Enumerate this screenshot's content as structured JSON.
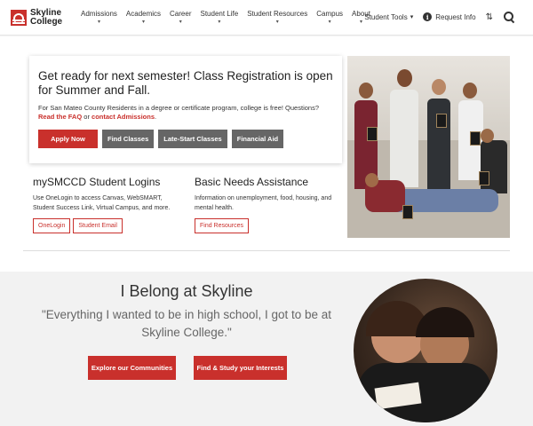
{
  "header": {
    "logo_line1": "Skyline",
    "logo_line2": "College",
    "nav": [
      {
        "label": "Admissions",
        "caret": "▾"
      },
      {
        "label": "Academics",
        "caret": "▾"
      },
      {
        "label": "Career",
        "caret": "▾"
      },
      {
        "label": "Student Life",
        "caret": "▾"
      },
      {
        "label": "Student Resources",
        "caret": "▾"
      },
      {
        "label": "Campus",
        "caret": "▾"
      },
      {
        "label": "About",
        "caret": "▾"
      }
    ],
    "student_tools": "Student Tools",
    "student_tools_caret": "▾",
    "request_info": "Request Info",
    "info_glyph": "i",
    "sort_glyph": "⇅",
    "icons": [
      "skyline-logo",
      "info-icon",
      "sort-icon",
      "search-icon"
    ]
  },
  "registration": {
    "title": "Get ready for next semester! Class Registration is open for Summer and Fall.",
    "text_before": "For San Mateo County Residents in a degree or certificate program, college is free! Questions?",
    "faq_link": "Read the FAQ",
    "text_or": " or ",
    "admissions_link": "contact Admissions",
    "text_end": ".",
    "buttons": {
      "apply": "Apply Now",
      "find_classes": "Find Classes",
      "late_start": "Late-Start Classes",
      "financial_aid": "Financial Aid"
    }
  },
  "logins": {
    "title": "mySMCCD Student Logins",
    "text": "Use OneLogin to access Canvas, WebSMART, Student Success Link, Virtual Campus, and more.",
    "onelogin": "OneLogin",
    "student_email": "Student Email"
  },
  "basic_needs": {
    "title": "Basic Needs Assistance",
    "text": "Information on unemployment, food, housing, and mental health.",
    "find_resources": "Find Resources"
  },
  "belong": {
    "title": "I Belong at Skyline",
    "quote": "\"Everything I wanted to be in high school, I got to be at Skyline College.\"",
    "explore": "Explore our Communities",
    "find_study": "Find & Study your Interests"
  },
  "colors": {
    "accent": "#c9302c",
    "gray_button": "#666666",
    "section_bg": "#f2f2f2"
  }
}
